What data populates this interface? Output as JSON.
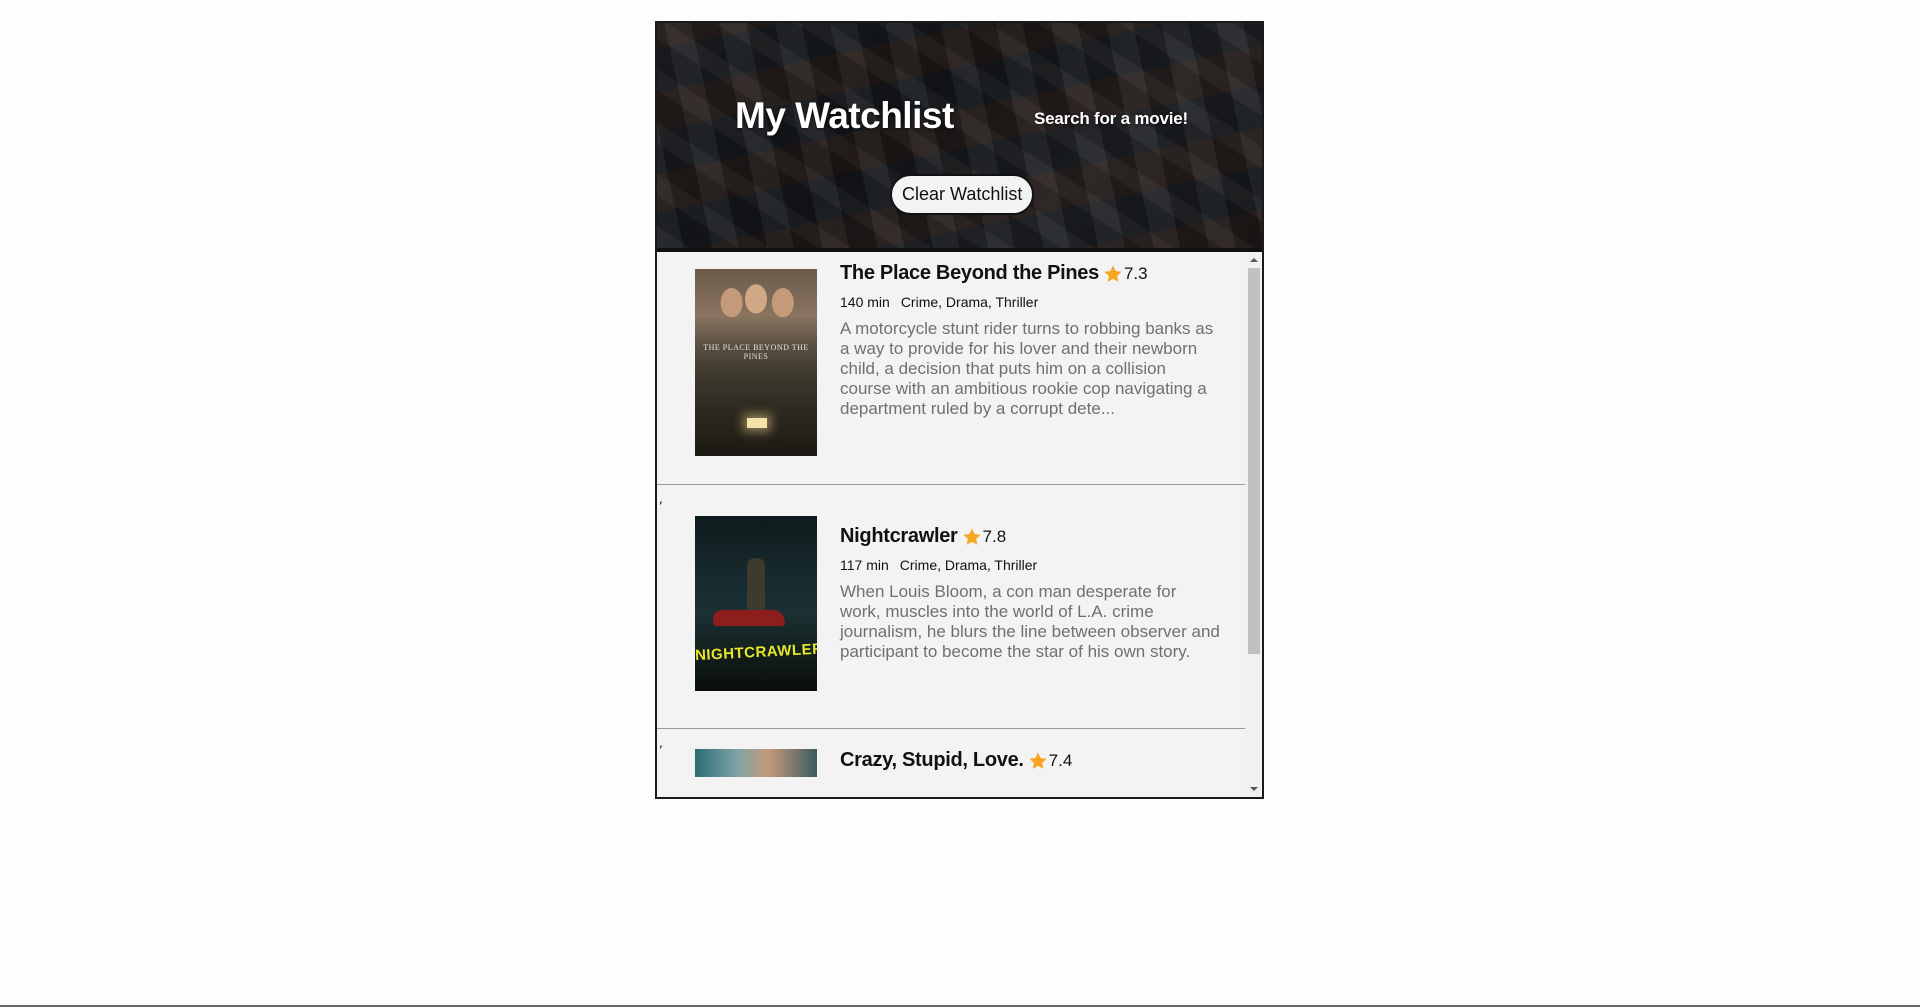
{
  "header": {
    "title": "My Watchlist",
    "search_link": "Search for a movie!",
    "clear_button": "Clear Watchlist"
  },
  "colors": {
    "star": "#f5a623",
    "plot_text": "#707070",
    "list_background": "#f3f3f3"
  },
  "movies": [
    {
      "title": "The Place Beyond the Pines",
      "rating": "7.3",
      "runtime": "140 min",
      "genres": "Crime, Drama, Thriller",
      "plot": "A motorcycle stunt rider turns to robbing banks as a way to provide for his lover and their newborn child, a decision that puts him on a collision course with an ambitious rookie cop navigating a department ruled by a corrupt dete...",
      "poster_text": "THE PLACE BEYOND THE PINES"
    },
    {
      "title": "Nightcrawler",
      "rating": "7.8",
      "runtime": "117 min",
      "genres": "Crime, Drama, Thriller",
      "plot": "When Louis Bloom, a con man desperate for work, muscles into the world of L.A. crime journalism, he blurs the line between observer and participant to become the star of his own story.",
      "poster_text": "NIGHTCRAWLER"
    },
    {
      "title": "Crazy, Stupid, Love.",
      "rating": "7.4"
    }
  ],
  "separator_mark": ","
}
